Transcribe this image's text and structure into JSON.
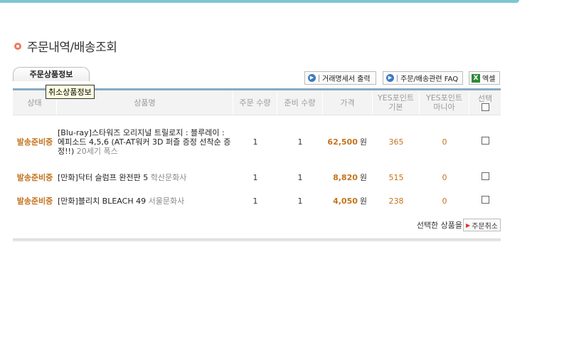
{
  "page": {
    "title": "주문내역/배송조회",
    "tab_label": "주문상품정보",
    "tooltip": "취소상품정보"
  },
  "toolbar": {
    "print_label": "거래명세서 출력",
    "faq_label": "주문/배송관련 FAQ",
    "excel_label": "엑셀",
    "excel_icon_glyph": "X"
  },
  "table": {
    "headers": {
      "status": "상태",
      "product": "상품명",
      "order_qty": "주문 수량",
      "ready_qty": "준비 수량",
      "price": "가격",
      "points_basic_1": "YES포인트",
      "points_basic_2": "기본",
      "points_mania_1": "YES포인트",
      "points_mania_2": "마니아",
      "select": "선택"
    },
    "rows": [
      {
        "status": "발송준비중",
        "product": "[Blu-ray]스타워즈 오리지널 트릴로지 : 블루레이 : 에피소드 4,5,6 (AT-AT워커 3D 퍼즐 증정 선착순 증정!!)",
        "publisher": "20세기 폭스",
        "order_qty": "1",
        "ready_qty": "1",
        "price": "62,500",
        "currency": "원",
        "points_basic": "365",
        "points_mania": "0"
      },
      {
        "status": "발송준비중",
        "product": "[만화]닥터 슬럼프 완전판 5",
        "publisher": "학산문화사",
        "order_qty": "1",
        "ready_qty": "1",
        "price": "8,820",
        "currency": "원",
        "points_basic": "515",
        "points_mania": "0"
      },
      {
        "status": "발송준비중",
        "product": "[만화]블리치 BLEACH 49",
        "publisher": "서울문화사",
        "order_qty": "1",
        "ready_qty": "1",
        "price": "4,050",
        "currency": "원",
        "points_basic": "238",
        "points_mania": "0"
      }
    ],
    "footer_text": "선택한 상품을",
    "cancel_label": "주문취소"
  },
  "colors": {
    "accent_orange": "#c4731e",
    "header_line": "#88aac4",
    "top_bar": "#7fc6d2"
  }
}
